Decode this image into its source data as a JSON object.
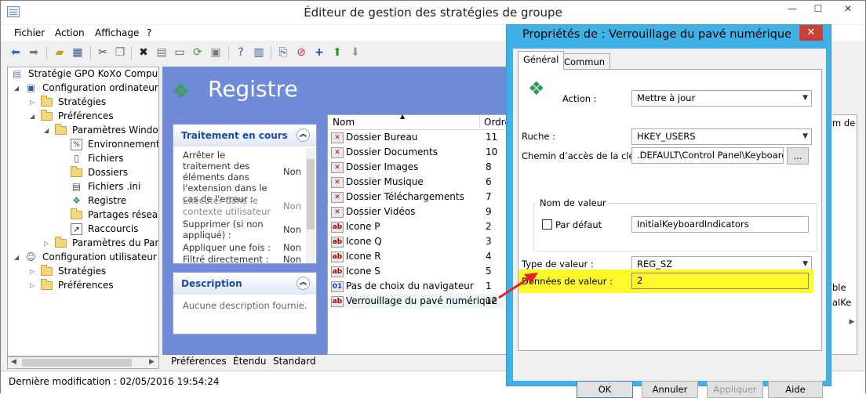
{
  "window": {
    "title": "Éditeur de gestion des stratégies de groupe",
    "controls": {
      "minimize": "—",
      "maximize": "☐",
      "close": "✕"
    }
  },
  "menubar": {
    "items": [
      "Fichier",
      "Action",
      "Affichage",
      "?"
    ]
  },
  "toolbar": {
    "icons": [
      "back-arrow-icon",
      "forward-arrow-icon",
      "up-folder-icon",
      "show-tree-icon",
      "cut-icon",
      "copy-icon",
      "delete-icon",
      "properties-icon",
      "print-icon",
      "refresh-icon",
      "export-icon",
      "help-icon",
      "mmc-icon",
      "new-item-icon",
      "stop-icon",
      "add-icon",
      "move-up-icon",
      "move-down-icon"
    ]
  },
  "tree": {
    "items": [
      {
        "label": "Stratégie GPO KoXo Computers",
        "icon": "gpo-icon",
        "arrow": ""
      },
      {
        "label": "Configuration ordinateur",
        "icon": "computer-config-icon",
        "arrow": "◢"
      },
      {
        "label": "Stratégies",
        "icon": "folder-icon",
        "arrow": "▷"
      },
      {
        "label": "Préférences",
        "icon": "folder-icon",
        "arrow": "◢"
      },
      {
        "label": "Paramètres Windows",
        "icon": "folder-icon",
        "arrow": "◢"
      },
      {
        "label": "Environnement",
        "icon": "environment-icon",
        "arrow": ""
      },
      {
        "label": "Fichiers",
        "icon": "files-icon",
        "arrow": ""
      },
      {
        "label": "Dossiers",
        "icon": "folders-icon",
        "arrow": ""
      },
      {
        "label": "Fichiers .ini",
        "icon": "ini-icon",
        "arrow": ""
      },
      {
        "label": "Registre",
        "icon": "registry-icon",
        "arrow": ""
      },
      {
        "label": "Partages réseau",
        "icon": "network-share-icon",
        "arrow": ""
      },
      {
        "label": "Raccourcis",
        "icon": "shortcut-icon",
        "arrow": ""
      },
      {
        "label": "Paramètres du Panne",
        "icon": "folder-icon",
        "arrow": "▷"
      },
      {
        "label": "Configuration utilisateur",
        "icon": "user-config-icon",
        "arrow": "◢"
      },
      {
        "label": "Stratégies",
        "icon": "folder-icon",
        "arrow": "▷"
      },
      {
        "label": "Préférences",
        "icon": "folder-icon",
        "arrow": "▷"
      }
    ]
  },
  "content": {
    "heading": "Registre",
    "processing": {
      "title": "Traitement en cours",
      "rows": [
        {
          "label": "Arrêter le traitement des éléments dans l'extension dans le cas de l'erreur :",
          "value": "Non",
          "grey": false
        },
        {
          "label": "Exécuter dans le contexte utilisateur :",
          "value": "Non",
          "grey": true
        },
        {
          "label": "Supprimer (si non appliqué) :",
          "value": "Non",
          "grey": false
        },
        {
          "label": "Appliquer une fois :",
          "value": "Non",
          "grey": false
        },
        {
          "label": "Filtré directement :",
          "value": "Non",
          "grey": false
        }
      ]
    },
    "description": {
      "title": "Description",
      "text": "Aucune description fournie."
    }
  },
  "list": {
    "columns": {
      "name": "Nom",
      "order": "Ordre"
    },
    "rows": [
      {
        "name": "Dossier Bureau",
        "order": "11",
        "icon": "registry-value-icon"
      },
      {
        "name": "Dossier Documents",
        "order": "10",
        "icon": "registry-value-icon"
      },
      {
        "name": "Dossier Images",
        "order": "8",
        "icon": "registry-value-icon"
      },
      {
        "name": "Dossier Musique",
        "order": "6",
        "icon": "registry-value-icon"
      },
      {
        "name": "Dossier Téléchargements",
        "order": "7",
        "icon": "registry-value-icon"
      },
      {
        "name": "Dossier Vidéos",
        "order": "9",
        "icon": "registry-value-icon"
      },
      {
        "name": "Icone P",
        "order": "2",
        "icon": "registry-string-icon"
      },
      {
        "name": "Icone Q",
        "order": "3",
        "icon": "registry-string-icon"
      },
      {
        "name": "Icone R",
        "order": "4",
        "icon": "registry-string-icon"
      },
      {
        "name": "Icone S",
        "order": "5",
        "icon": "registry-string-icon"
      },
      {
        "name": "Pas de choix du navigateur",
        "order": "1",
        "icon": "registry-binary-icon"
      },
      {
        "name": "Verrouillage du pavé numérique",
        "order": "12",
        "icon": "registry-string-icon"
      }
    ],
    "behind_right": {
      "col": "m de",
      "row1": "ble",
      "row2": "alKe"
    }
  },
  "sheet_tabs": [
    "Préférences",
    "Étendu",
    "Standard"
  ],
  "status": {
    "text": "Dernière modification : 02/05/2016 19:54:24"
  },
  "dialog": {
    "title": "Propriétés de : Verrouillage du pavé numérique",
    "close": "✕",
    "tabs": [
      "Général",
      "Commun"
    ],
    "action_label": "Action :",
    "action_value": "Mettre à jour",
    "hive_label": "Ruche :",
    "hive_value": "HKEY_USERS",
    "keypath_label": "Chemin d’accès de la clé :",
    "keypath_value": ".DEFAULT\\Control Panel\\Keyboard",
    "browse": "...",
    "valuename_group": "Nom de valeur",
    "default_label": "Par défaut",
    "valuename_value": "InitialKeyboardIndicators",
    "valuetype_label": "Type de valeur :",
    "valuetype_value": "REG_SZ",
    "valuedata_label": "Données de valeur :",
    "valuedata_value": "2",
    "buttons": {
      "ok": "OK",
      "cancel": "Annuler",
      "apply": "Appliquer",
      "help": "Aide"
    }
  },
  "colors": {
    "highlight": "#fff82a",
    "dialog_border": "#3fb1e6",
    "close_red": "#c7413a",
    "content_blue": "#6f8bd7",
    "arrow_red": "#e52323"
  }
}
